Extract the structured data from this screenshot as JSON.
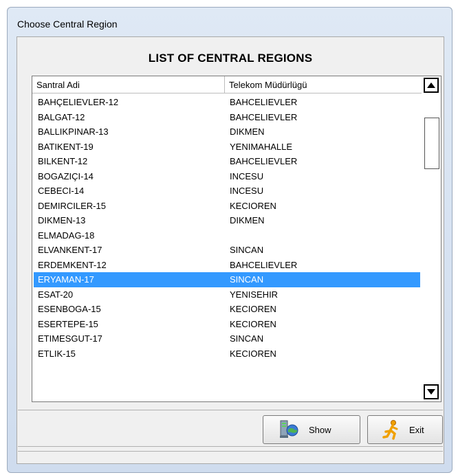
{
  "window": {
    "title": "Choose Central Region"
  },
  "heading": "LIST OF CENTRAL REGIONS",
  "table": {
    "columns": [
      "Santral Adi",
      "Telekom Müdürlügü"
    ],
    "rows": [
      [
        "BAHÇELIEVLER-12",
        "BAHCELIEVLER"
      ],
      [
        "BALGAT-12",
        "BAHCELIEVLER"
      ],
      [
        "BALLIKPINAR-13",
        "DIKMEN"
      ],
      [
        "BATIKENT-19",
        "YENIMAHALLE"
      ],
      [
        "BILKENT-12",
        "BAHCELIEVLER"
      ],
      [
        "BOGAZIÇI-14",
        "INCESU"
      ],
      [
        "CEBECI-14",
        "INCESU"
      ],
      [
        "DEMIRCILER-15",
        "KECIOREN"
      ],
      [
        "DIKMEN-13",
        "DIKMEN"
      ],
      [
        "ELMADAG-18",
        ""
      ],
      [
        "ELVANKENT-17",
        "SINCAN"
      ],
      [
        "ERDEMKENT-12",
        "BAHCELIEVLER"
      ],
      [
        "ERYAMAN-17",
        "SINCAN"
      ],
      [
        "ESAT-20",
        "YENISEHIR"
      ],
      [
        "ESENBOGA-15",
        "KECIOREN"
      ],
      [
        "ESERTEPE-15",
        "KECIOREN"
      ],
      [
        "ETIMESGUT-17",
        "SINCAN"
      ],
      [
        "ETLIK-15",
        "KECIOREN"
      ]
    ],
    "selected_index": 12,
    "selection_color": "#3399ff"
  },
  "scrollbar": {
    "up_icon": "scroll-up-arrow",
    "down_icon": "scroll-down-arrow"
  },
  "buttons": {
    "show_label": "Show",
    "show_icon": "computer-globe-icon",
    "exit_label": "Exit",
    "exit_icon": "running-man-icon"
  }
}
